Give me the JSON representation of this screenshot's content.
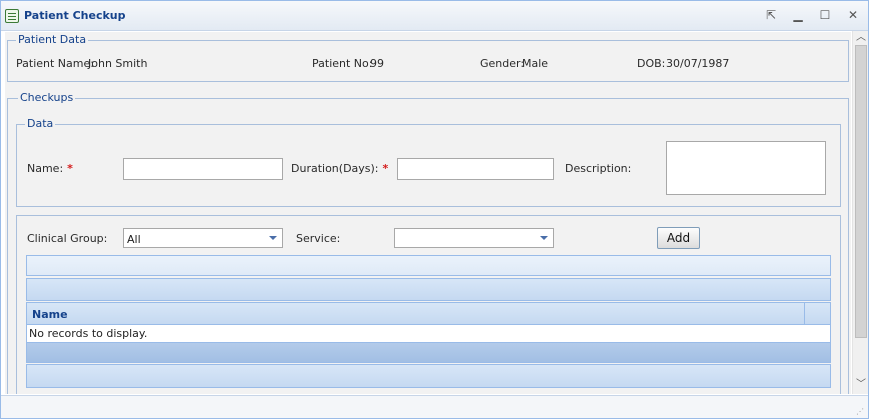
{
  "window": {
    "title": "Patient Checkup",
    "controls": {
      "pin_icon": "pin-icon",
      "minimize_icon": "minimize-icon",
      "maximize_icon": "maximize-icon",
      "close_icon": "close-icon"
    }
  },
  "patient_data": {
    "legend": "Patient Data",
    "name_label": "Patient Name:",
    "name_value": "John Smith",
    "no_label": "Patient No:",
    "no_value": "99",
    "gender_label": "Gender:",
    "gender_value": "Male",
    "dob_label": "DOB:",
    "dob_value": "30/07/1987"
  },
  "checkups": {
    "legend": "Checkups",
    "data": {
      "legend": "Data",
      "name_label": "Name:",
      "name_value": "",
      "duration_label": "Duration(Days):",
      "duration_value": "",
      "description_label": "Description:",
      "description_value": "",
      "required_marker": "*"
    },
    "service_section": {
      "clinical_group_label": "Clinical Group:",
      "clinical_group_value": "All",
      "service_label": "Service:",
      "service_value": "",
      "add_label": "Add"
    },
    "grid": {
      "columns": [
        "Name"
      ],
      "empty_text": "No records to display."
    }
  },
  "colors": {
    "accent": "#15428b",
    "border": "#99bbe8",
    "required": "#d41b1b"
  }
}
